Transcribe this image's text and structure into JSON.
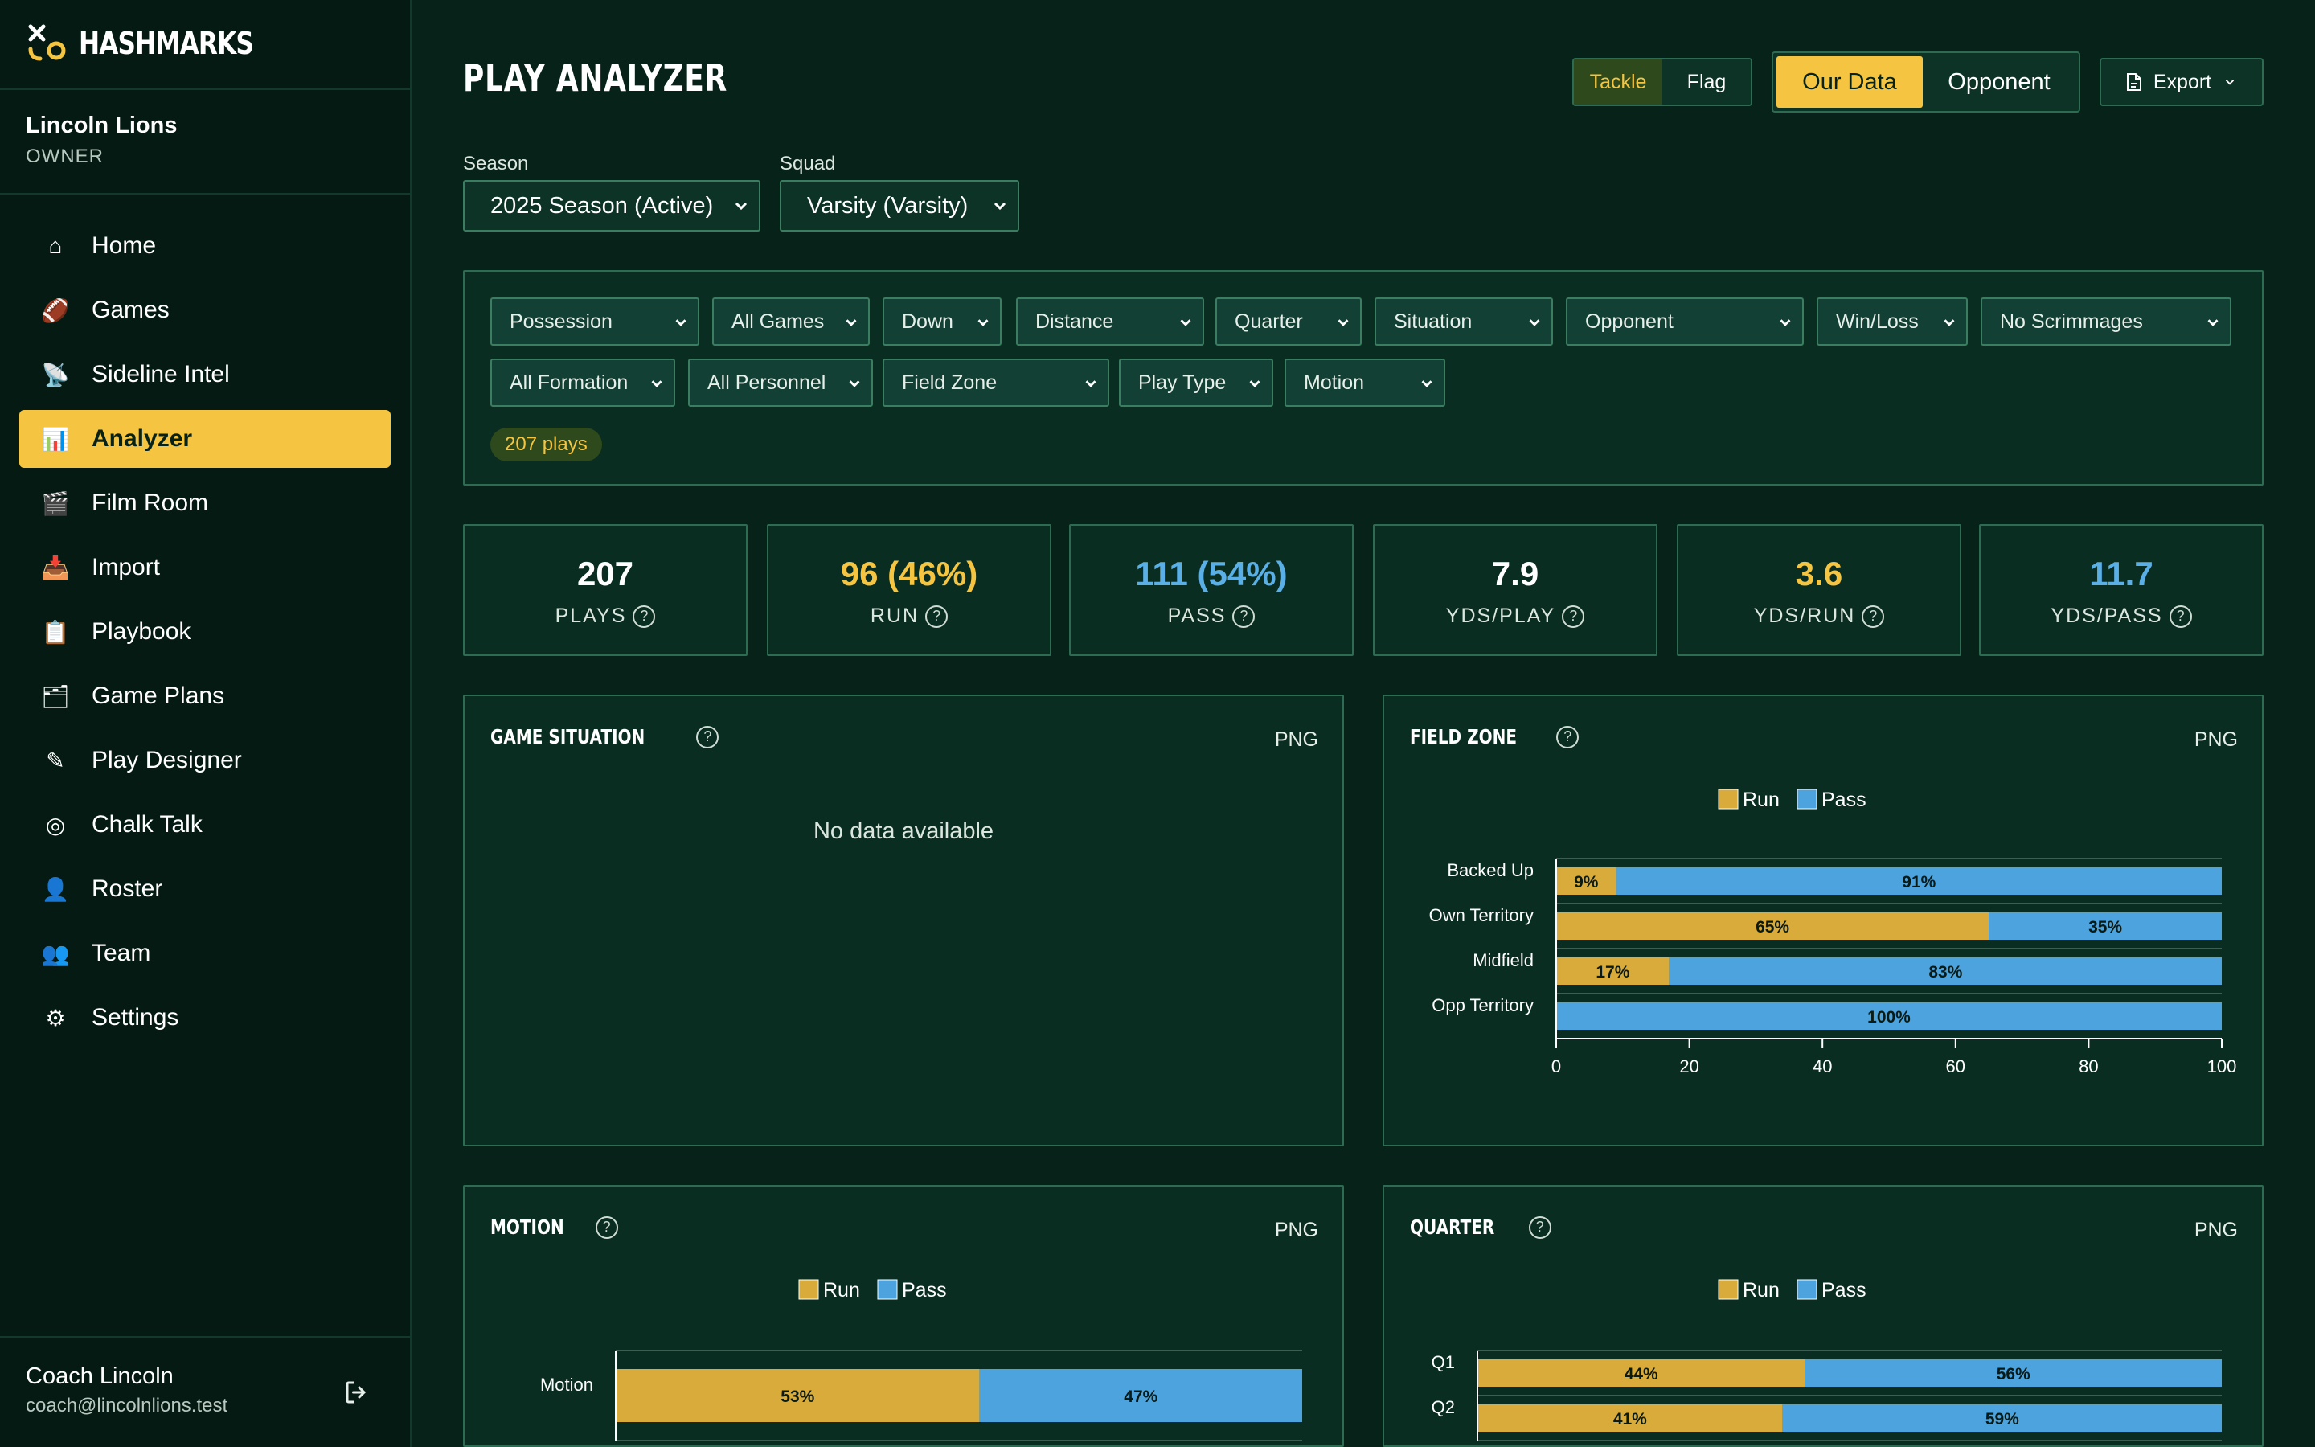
{
  "brand": {
    "name": "HASHMARKS",
    "logo_icon": "x-o-logo-icon"
  },
  "team": {
    "name": "Lincoln Lions",
    "role": "OWNER"
  },
  "nav": [
    {
      "label": "Home",
      "icon": "⌂",
      "active": false
    },
    {
      "label": "Games",
      "icon": "🏈",
      "active": false
    },
    {
      "label": "Sideline Intel",
      "icon": "📡",
      "active": false
    },
    {
      "label": "Analyzer",
      "icon": "📊",
      "active": true
    },
    {
      "label": "Film Room",
      "icon": "🎬",
      "active": false
    },
    {
      "label": "Import",
      "icon": "📥",
      "active": false
    },
    {
      "label": "Playbook",
      "icon": "📋",
      "active": false
    },
    {
      "label": "Game Plans",
      "icon": "🗂",
      "active": false
    },
    {
      "label": "Play Designer",
      "icon": "✎",
      "active": false
    },
    {
      "label": "Chalk Talk",
      "icon": "◎",
      "active": false
    },
    {
      "label": "Roster",
      "icon": "👤",
      "active": false
    },
    {
      "label": "Team",
      "icon": "👥",
      "active": false
    },
    {
      "label": "Settings",
      "icon": "⚙",
      "active": false
    }
  ],
  "user": {
    "name": "Coach Lincoln",
    "email": "coach@lincolnlions.test"
  },
  "header": {
    "title": "PLAY ANALYZER",
    "game_type": {
      "selected": "Tackle",
      "other": "Flag"
    },
    "data_source": {
      "selected": "Our Data",
      "other": "Opponent"
    },
    "export_label": "Export"
  },
  "season": {
    "label": "Season",
    "value": "2025 Season (Active)"
  },
  "squad": {
    "label": "Squad",
    "value": "Varsity (Varsity)"
  },
  "filters": {
    "row1": [
      "Possession",
      "All Games",
      "Down",
      "Distance",
      "Quarter",
      "Situation",
      "Opponent",
      "Win/Loss",
      "No Scrimmages"
    ],
    "row2": [
      "All Formation",
      "All Personnel",
      "Field Zone",
      "Play Type",
      "Motion"
    ],
    "plays_badge": "207 plays"
  },
  "stats": [
    {
      "value": "207",
      "label": "PLAYS",
      "color": "#ffffff"
    },
    {
      "value": "96 (46%)",
      "label": "RUN",
      "color": "#f5c542"
    },
    {
      "value": "111 (54%)",
      "label": "PASS",
      "color": "#5aafe6"
    },
    {
      "value": "7.9",
      "label": "YDS/PLAY",
      "color": "#ffffff"
    },
    {
      "value": "3.6",
      "label": "YDS/RUN",
      "color": "#f5c542"
    },
    {
      "value": "11.7",
      "label": "YDS/PASS",
      "color": "#5aafe6"
    }
  ],
  "panels": {
    "game_situation": {
      "title": "GAME SITUATION",
      "png": "PNG",
      "empty_text": "No data available"
    },
    "field_zone": {
      "title": "FIELD ZONE",
      "png": "PNG"
    },
    "motion": {
      "title": "MOTION",
      "png": "PNG"
    },
    "quarter": {
      "title": "QUARTER",
      "png": "PNG"
    }
  },
  "colors": {
    "run": "#d9ab3a",
    "pass": "#4ca3dd",
    "accent": "#f5c542"
  },
  "chart_data": [
    {
      "id": "field_zone",
      "type": "bar",
      "orientation": "horizontal",
      "stacked": true,
      "categories": [
        "Backed Up",
        "Own Territory",
        "Midfield",
        "Opp Territory"
      ],
      "series": [
        {
          "name": "Run",
          "values": [
            9,
            65,
            17,
            0
          ]
        },
        {
          "name": "Pass",
          "values": [
            91,
            35,
            83,
            100
          ]
        }
      ],
      "xlim": [
        0,
        100
      ],
      "xticks": [
        0,
        20,
        40,
        60,
        80,
        100
      ],
      "legend": "top-center"
    },
    {
      "id": "motion",
      "type": "bar",
      "orientation": "horizontal",
      "stacked": true,
      "categories": [
        "Motion"
      ],
      "series": [
        {
          "name": "Run",
          "values": [
            53
          ]
        },
        {
          "name": "Pass",
          "values": [
            47
          ]
        }
      ],
      "xlim": [
        0,
        100
      ],
      "legend": "top-center"
    },
    {
      "id": "quarter",
      "type": "bar",
      "orientation": "horizontal",
      "stacked": true,
      "categories": [
        "Q1",
        "Q2"
      ],
      "series": [
        {
          "name": "Run",
          "values": [
            44,
            41
          ]
        },
        {
          "name": "Pass",
          "values": [
            56,
            59
          ]
        }
      ],
      "xlim": [
        0,
        100
      ],
      "legend": "top-center"
    }
  ]
}
